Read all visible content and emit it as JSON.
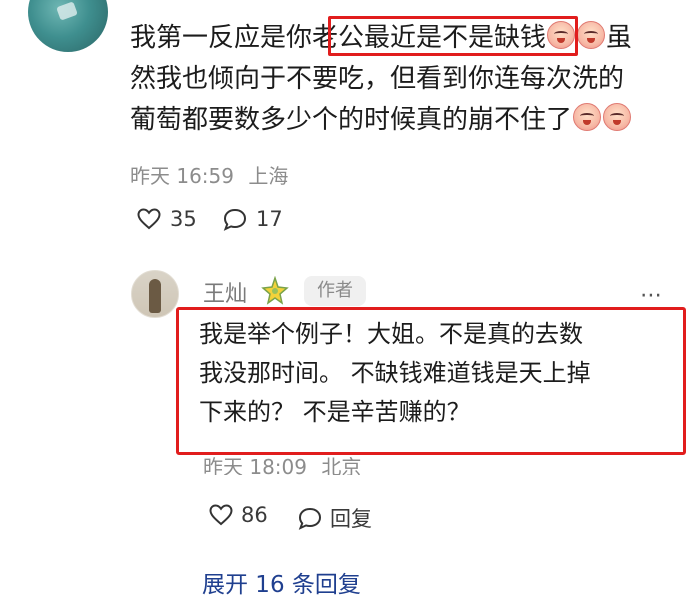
{
  "comment": {
    "text_line1": "我第一反应是你老公最近是不是缺钱",
    "text_line1b": "虽",
    "text_line2": "然我也倾向于不要吃，但看到你连每次洗的",
    "text_line3": "葡萄都要数多少个的时候真的崩不住了",
    "emoji_icon": "crying-face-icon",
    "time": "昨天 16:59",
    "location": "上海",
    "like_count": "35",
    "reply_count": "17"
  },
  "reply": {
    "author": "王灿",
    "author_badge_icon": "sparkle-badge-icon",
    "author_tag": "作者",
    "more_icon": "more-dots-icon",
    "text": "我是举个例子！大姐。不是真的去数\n我没那时间。 不缺钱难道钱是天上掉\n下来的？ 不是辛苦赚的？",
    "time": "昨天 18:09",
    "location": "北京",
    "like_count": "86",
    "reply_label": "回复"
  },
  "expand": {
    "label": "展开 16 条回复"
  },
  "colors": {
    "highlight": "#e11d1d",
    "link": "#1f3f8f",
    "meta": "#8c8c8c"
  }
}
